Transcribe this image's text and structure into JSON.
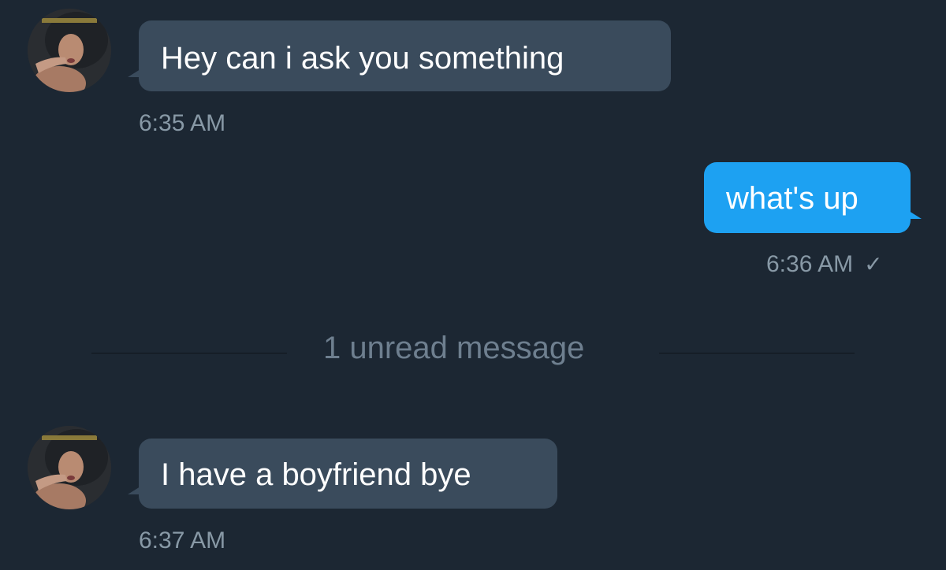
{
  "conversation": {
    "messages": [
      {
        "direction": "incoming",
        "text": "Hey can i ask you something",
        "time": "6:35 AM"
      },
      {
        "direction": "outgoing",
        "text": "what's up",
        "time": "6:36 AM",
        "status_icon": "checkmark-icon"
      },
      {
        "direction": "incoming",
        "text": "I have a boyfriend bye",
        "time": "6:37 AM"
      }
    ],
    "unread_divider": "1 unread message"
  },
  "colors": {
    "background": "#1c2733",
    "incoming_bubble": "#3a4b5c",
    "outgoing_bubble": "#1da1f2",
    "timestamp": "#8899a6",
    "divider_text": "#6e7f8f"
  },
  "icons": {
    "read_status": "checkmark-icon",
    "avatar": "user-avatar"
  }
}
